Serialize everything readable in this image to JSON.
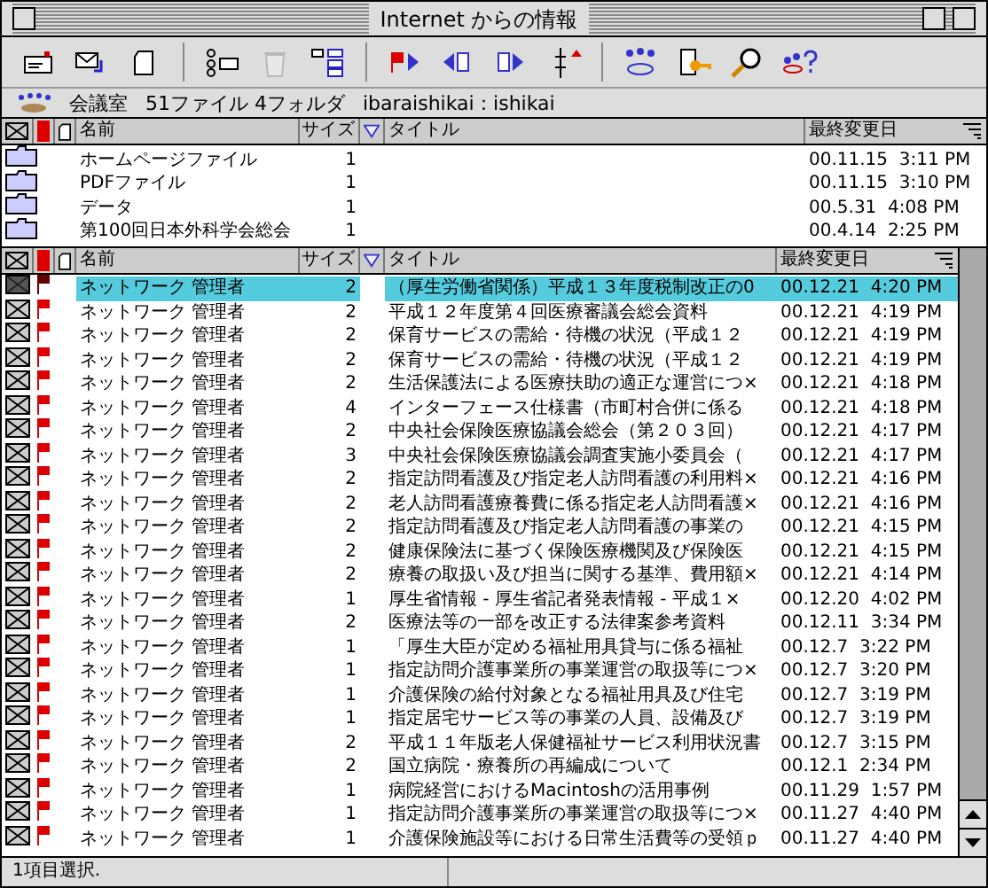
{
  "window": {
    "title": "Internet からの情報"
  },
  "toolbar": [
    [
      {
        "kind": "card",
        "disabled": false
      },
      {
        "kind": "envelope",
        "disabled": false
      },
      {
        "kind": "document",
        "disabled": false
      }
    ],
    [
      {
        "kind": "checklist",
        "disabled": false
      },
      {
        "kind": "trash",
        "disabled": true
      },
      {
        "kind": "outline",
        "disabled": false
      }
    ],
    [
      {
        "kind": "flag",
        "disabled": false
      },
      {
        "kind": "left",
        "disabled": false
      },
      {
        "kind": "right",
        "disabled": false
      },
      {
        "kind": "updown",
        "disabled": false
      }
    ],
    [
      {
        "kind": "people",
        "disabled": false
      },
      {
        "kind": "key",
        "disabled": false
      },
      {
        "kind": "search",
        "disabled": false
      },
      {
        "kind": "help",
        "disabled": false
      }
    ]
  ],
  "info_bar": {
    "room": "会議室",
    "counts": "51ファイル 4フォルダ",
    "account": "ibaraishikai : ishikai"
  },
  "folders": {
    "columns": [
      "名前",
      "サイズ",
      "タイトル",
      "最終変更日"
    ],
    "rows": [
      {
        "name": "ホームページファイル",
        "size": "1",
        "date": "00.11.15",
        "time": "3:11 PM"
      },
      {
        "name": "PDFファイル",
        "size": "1",
        "date": "00.11.15",
        "time": "3:10 PM"
      },
      {
        "name": "データ",
        "size": "1",
        "date": "00.5.31",
        "time": "4:08 PM"
      },
      {
        "name": "第100回日本外科学会総会",
        "size": "1",
        "date": "00.4.14",
        "time": "2:25 PM"
      }
    ]
  },
  "messages": {
    "columns": [
      "名前",
      "サイズ",
      "タイトル",
      "最終変更日"
    ],
    "rows": [
      {
        "selected": true,
        "name": "ネットワーク 管理者",
        "size": "2",
        "title": "（厚生労働省関係）平成１３年度税制改正の0",
        "date": "00.12.21",
        "time": "4:20 PM"
      },
      {
        "selected": false,
        "name": "ネットワーク 管理者",
        "size": "2",
        "title": "平成１２年度第４回医療審議会総会資料",
        "date": "00.12.21",
        "time": "4:19 PM"
      },
      {
        "selected": false,
        "name": "ネットワーク 管理者",
        "size": "2",
        "title": "保育サービスの需給・待機の状況（平成１２",
        "date": "00.12.21",
        "time": "4:19 PM"
      },
      {
        "selected": false,
        "name": "ネットワーク 管理者",
        "size": "2",
        "title": "保育サービスの需給・待機の状況（平成１２",
        "date": "00.12.21",
        "time": "4:19 PM"
      },
      {
        "selected": false,
        "name": "ネットワーク 管理者",
        "size": "2",
        "title": "生活保護法による医療扶助の適正な運営につ×",
        "date": "00.12.21",
        "time": "4:18 PM"
      },
      {
        "selected": false,
        "name": "ネットワーク 管理者",
        "size": "4",
        "title": "インターフェース仕様書（市町村合併に係る",
        "date": "00.12.21",
        "time": "4:18 PM"
      },
      {
        "selected": false,
        "name": "ネットワーク 管理者",
        "size": "2",
        "title": "中央社会保険医療協議会総会（第２０３回）",
        "date": "00.12.21",
        "time": "4:17 PM"
      },
      {
        "selected": false,
        "name": "ネットワーク 管理者",
        "size": "3",
        "title": "中央社会保険医療協議会調査実施小委員会（",
        "date": "00.12.21",
        "time": "4:17 PM"
      },
      {
        "selected": false,
        "name": "ネットワーク 管理者",
        "size": "2",
        "title": "指定訪問看護及び指定老人訪問看護の利用料×",
        "date": "00.12.21",
        "time": "4:16 PM"
      },
      {
        "selected": false,
        "name": "ネットワーク 管理者",
        "size": "2",
        "title": "老人訪問看護療養費に係る指定老人訪問看護×",
        "date": "00.12.21",
        "time": "4:16 PM"
      },
      {
        "selected": false,
        "name": "ネットワーク 管理者",
        "size": "2",
        "title": "指定訪問看護及び指定老人訪問看護の事業の",
        "date": "00.12.21",
        "time": "4:15 PM"
      },
      {
        "selected": false,
        "name": "ネットワーク 管理者",
        "size": "2",
        "title": "健康保険法に基づく保険医療機関及び保険医",
        "date": "00.12.21",
        "time": "4:15 PM"
      },
      {
        "selected": false,
        "name": "ネットワーク 管理者",
        "size": "2",
        "title": "療養の取扱い及び担当に関する基準、費用額×",
        "date": "00.12.21",
        "time": "4:14 PM"
      },
      {
        "selected": false,
        "name": "ネットワーク 管理者",
        "size": "1",
        "title": "厚生省情報 - 厚生省記者発表情報 - 平成１×",
        "date": "00.12.20",
        "time": "4:02 PM"
      },
      {
        "selected": false,
        "name": "ネットワーク 管理者",
        "size": "2",
        "title": "医療法等の一部を改正する法律案参考資料",
        "date": "00.12.11",
        "time": "3:34 PM"
      },
      {
        "selected": false,
        "name": "ネットワーク 管理者",
        "size": "1",
        "title": "「厚生大臣が定める福祉用具貸与に係る福祉",
        "date": "00.12.7",
        "time": "3:22 PM"
      },
      {
        "selected": false,
        "name": "ネットワーク 管理者",
        "size": "1",
        "title": "指定訪問介護事業所の事業運営の取扱等につ×",
        "date": "00.12.7",
        "time": "3:20 PM"
      },
      {
        "selected": false,
        "name": "ネットワーク 管理者",
        "size": "1",
        "title": "介護保険の給付対象となる福祉用具及び住宅",
        "date": "00.12.7",
        "time": "3:19 PM"
      },
      {
        "selected": false,
        "name": "ネットワーク 管理者",
        "size": "1",
        "title": "指定居宅サービス等の事業の人員、設備及び",
        "date": "00.12.7",
        "time": "3:19 PM"
      },
      {
        "selected": false,
        "name": "ネットワーク 管理者",
        "size": "2",
        "title": "平成１１年版老人保健福祉サービス利用状況書",
        "date": "00.12.7",
        "time": "3:15 PM"
      },
      {
        "selected": false,
        "name": "ネットワーク 管理者",
        "size": "2",
        "title": "国立病院・療養所の再編成について",
        "date": "00.12.1",
        "time": "2:34 PM"
      },
      {
        "selected": false,
        "name": "ネットワーク 管理者",
        "size": "1",
        "title": "病院経営におけるMacintoshの活用事例",
        "date": "00.11.29",
        "time": "1:57 PM"
      },
      {
        "selected": false,
        "name": "ネットワーク 管理者",
        "size": "1",
        "title": "指定訪問介護事業所の事業運営の取扱等につ×",
        "date": "00.11.27",
        "time": "4:40 PM"
      },
      {
        "selected": false,
        "name": "ネットワーク 管理者",
        "size": "1",
        "title": "介護保険施設等における日常生活費等の受領ｐ",
        "date": "00.11.27",
        "time": "4:40 PM"
      }
    ]
  },
  "status_bar": {
    "text": "1項目選択."
  }
}
